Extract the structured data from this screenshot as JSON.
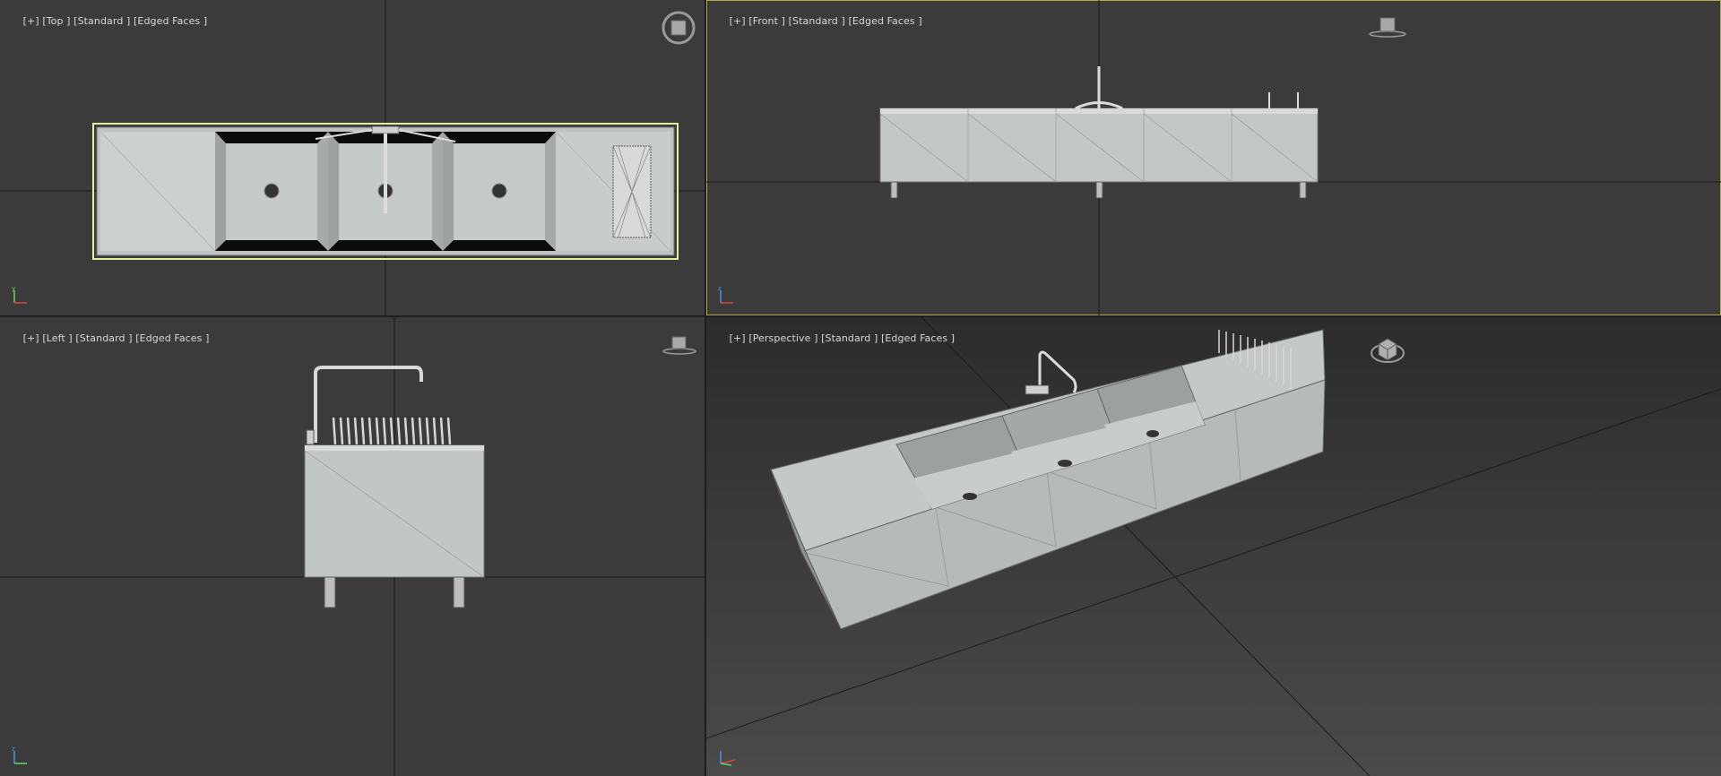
{
  "viewports": {
    "top": {
      "plus": "[+]",
      "view": "[Top ]",
      "shading": "[Standard ]",
      "edges": "[Edged Faces ]"
    },
    "front": {
      "plus": "[+]",
      "view": "[Front ]",
      "shading": "[Standard ]",
      "edges": "[Edged Faces ]"
    },
    "left": {
      "plus": "[+]",
      "view": "[Left ]",
      "shading": "[Standard ]",
      "edges": "[Edged Faces ]"
    },
    "persp": {
      "plus": "[+]",
      "view": "[Perspective ]",
      "shading": "[Standard ]",
      "edges": "[Edged Faces ]"
    }
  },
  "active_viewport": "front",
  "colors": {
    "viewport_bg": "#3b3b3b",
    "grid_line": "#1a1a1a",
    "selection": "#e8ef9a",
    "active_border": "#b8a84a",
    "metal_light": "#d4d6d6",
    "metal_dark": "#8e9090"
  },
  "icons": {
    "viewcube": "viewcube-icon",
    "axis": "axis-tripod-icon"
  }
}
